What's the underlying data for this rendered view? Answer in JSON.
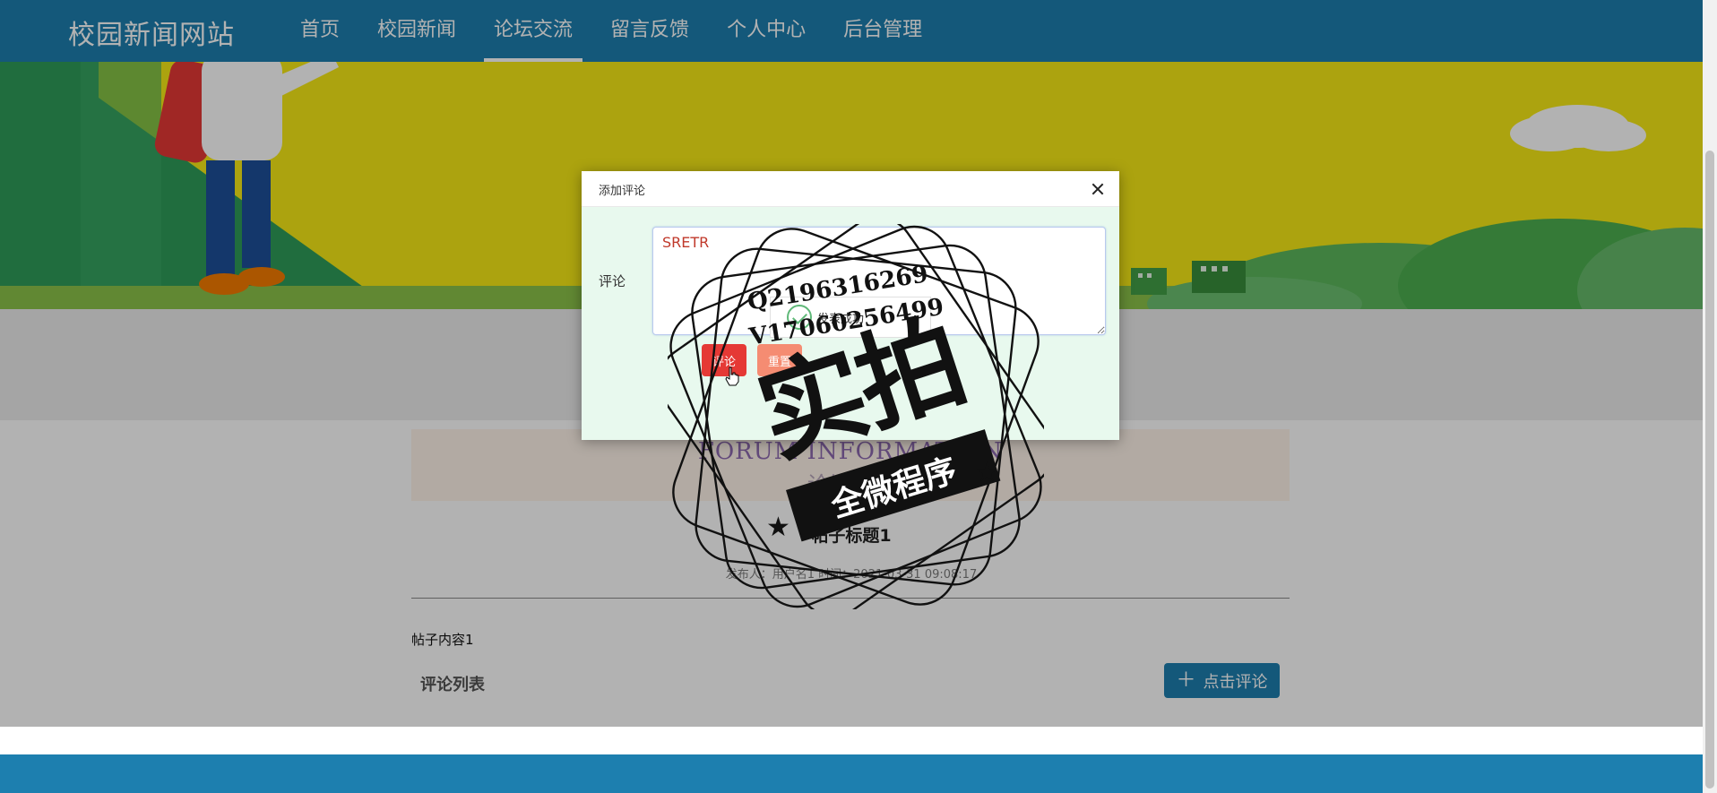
{
  "site": {
    "name": "校园新闻网站"
  },
  "nav": {
    "items": [
      {
        "label": "首页"
      },
      {
        "label": "校园新闻"
      },
      {
        "label": "论坛交流"
      },
      {
        "label": "留言反馈"
      },
      {
        "label": "个人中心"
      },
      {
        "label": "后台管理"
      }
    ],
    "active": "论坛交流"
  },
  "section": {
    "title_en": "FORUM INFORMATION",
    "title_cn": "论坛交流"
  },
  "post": {
    "title": "帖子标题1",
    "meta": "发布人：用户名1 时间：2021-03-31 09:08:17",
    "content": "帖子内容1"
  },
  "comments": {
    "list_title": "评论列表",
    "add_button_label": "点击评论",
    "add_button_icon": "plus-icon"
  },
  "modal": {
    "title": "添加评论",
    "field_label": "评论",
    "textarea_value": "SRETR",
    "submit_label": "评论",
    "reset_label": "重置"
  },
  "toast": {
    "message": "发表成功"
  },
  "watermark": {
    "line_q": "Q2196316269",
    "line_v": "V17060256499",
    "main": "实拍",
    "ribbon": "全微程序"
  },
  "colors": {
    "primary": "#1d7faf",
    "danger": "#e53935",
    "warning": "#f58c72",
    "modal_bg": "#e8f9ee",
    "banner_yellow": "#f7ea16"
  }
}
